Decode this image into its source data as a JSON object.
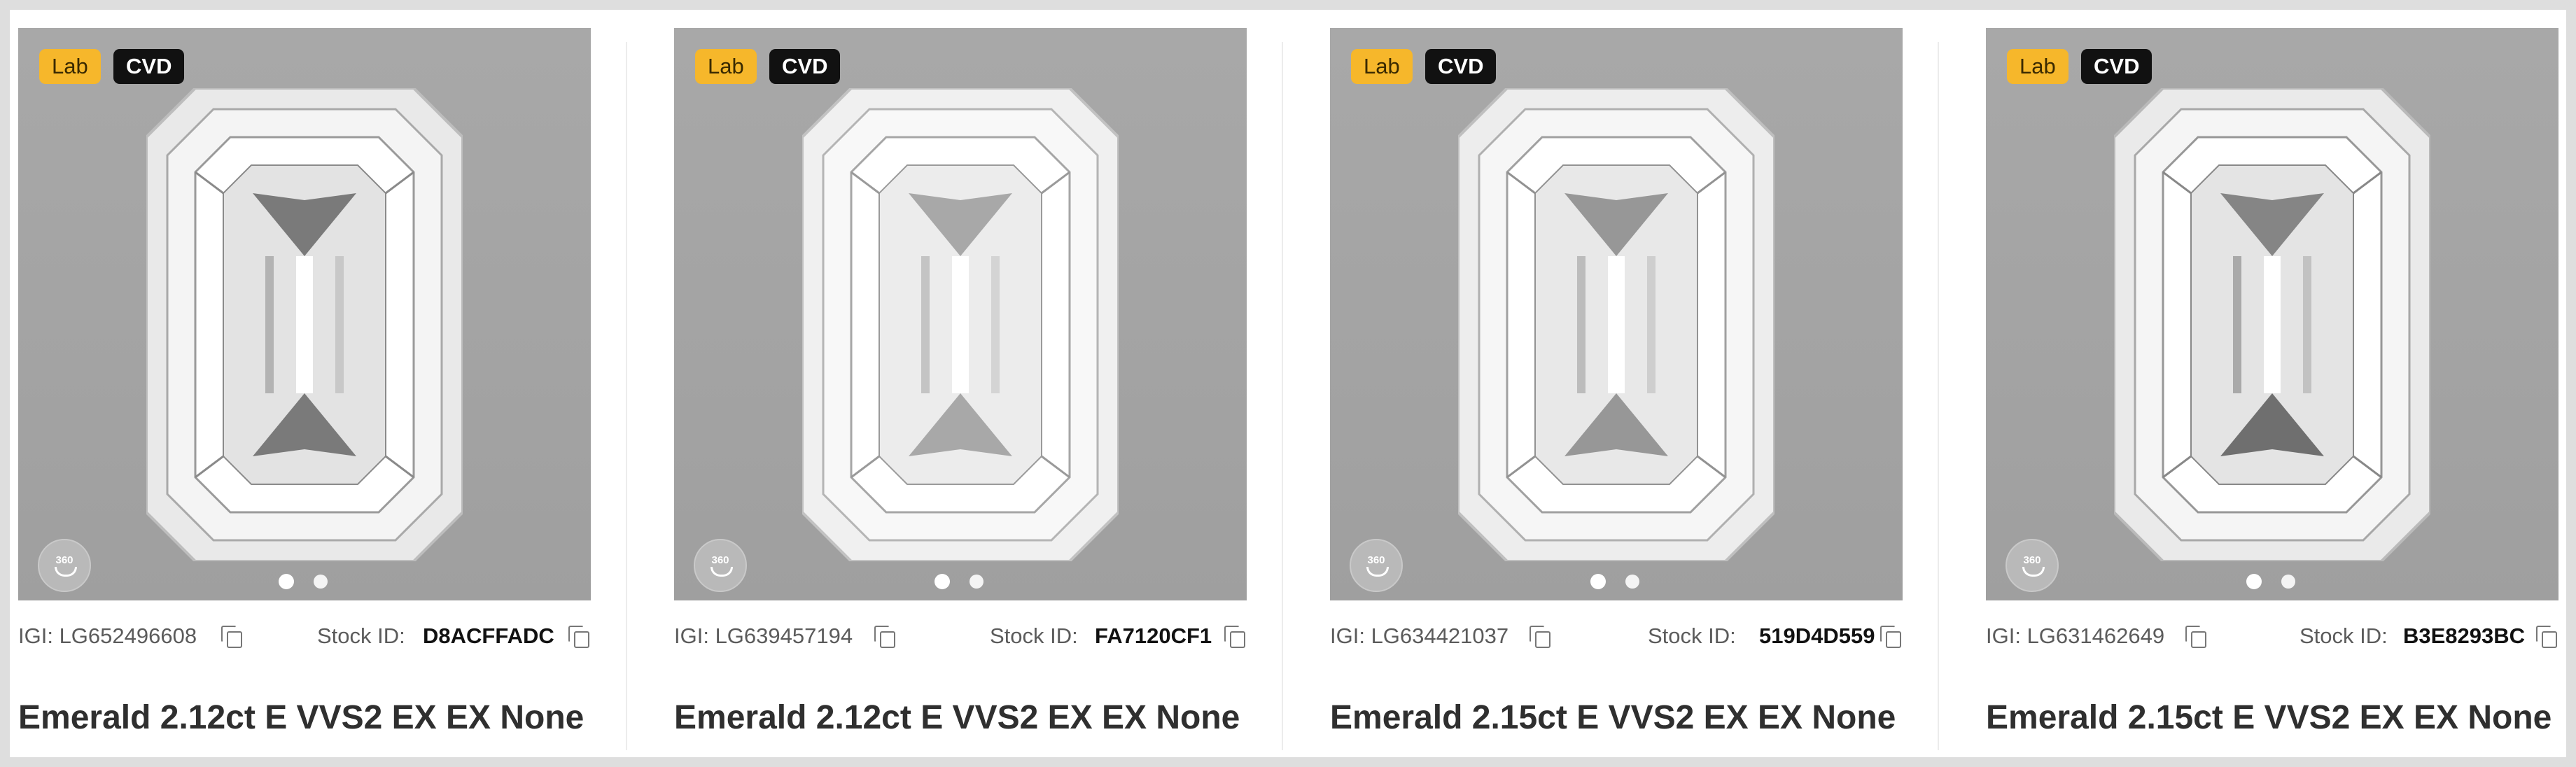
{
  "cards": [
    {
      "badge_lab": "Lab",
      "badge_cvd": "CVD",
      "igi": "IGI: LG652496608",
      "stock_label": "Stock ID:",
      "stock_id": "D8ACFFADC",
      "title": "Emerald 2.12ct E VVS2 EX EX None",
      "view360": "360"
    },
    {
      "badge_lab": "Lab",
      "badge_cvd": "CVD",
      "igi": "IGI: LG639457194",
      "stock_label": "Stock ID:",
      "stock_id": "FA7120CF1",
      "title": "Emerald 2.12ct E VVS2 EX EX None",
      "view360": "360"
    },
    {
      "badge_lab": "Lab",
      "badge_cvd": "CVD",
      "igi": "IGI: LG634421037",
      "stock_label": "Stock ID:",
      "stock_id": "519D4D559",
      "title": "Emerald 2.15ct E VVS2 EX EX None",
      "view360": "360"
    },
    {
      "badge_lab": "Lab",
      "badge_cvd": "CVD",
      "igi": "IGI: LG631462649",
      "stock_label": "Stock ID:",
      "stock_id": "B3E8293BC",
      "title": "Emerald 2.15ct E VVS2 EX EX None",
      "view360": "360"
    }
  ],
  "icons": {
    "copy": "copy-icon",
    "view360": "360-view-icon",
    "gem": "emerald-cut-diamond"
  },
  "colors": {
    "lab_badge": "#f6b72b",
    "cvd_badge": "#111111",
    "image_bg": "#a3a3a3",
    "frame": "#dedede"
  }
}
